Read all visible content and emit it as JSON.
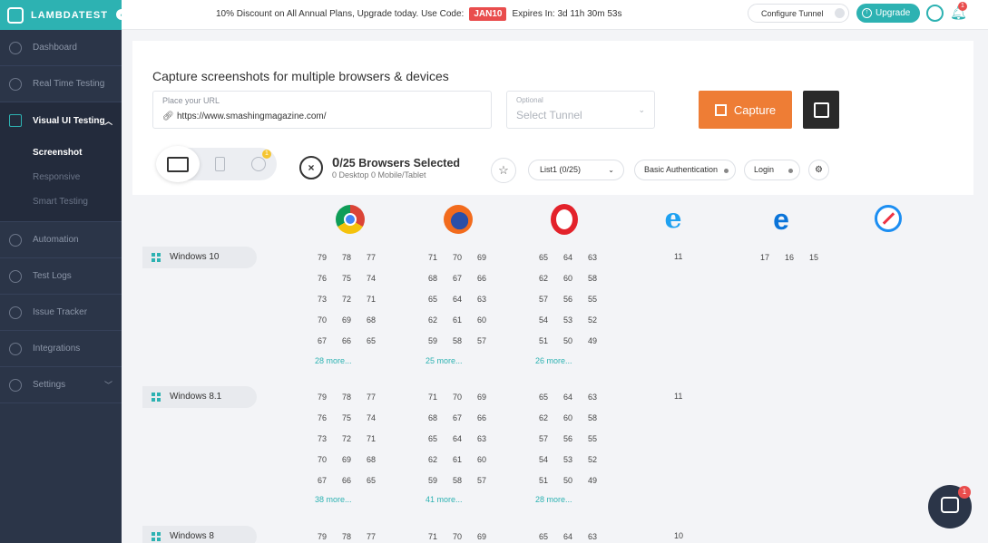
{
  "brand": {
    "name": "LAMBDATEST"
  },
  "sidebar": {
    "items": [
      {
        "label": "Dashboard",
        "icon": "dashboard-icon"
      },
      {
        "label": "Real Time Testing",
        "icon": "clock-icon"
      },
      {
        "label": "Visual UI Testing",
        "icon": "monitor-icon",
        "active": true
      },
      {
        "label": "Automation",
        "icon": "robot-icon"
      },
      {
        "label": "Test Logs",
        "icon": "box-icon"
      },
      {
        "label": "Issue Tracker",
        "icon": "bug-icon"
      },
      {
        "label": "Integrations",
        "icon": "plug-icon"
      },
      {
        "label": "Settings",
        "icon": "gear-icon"
      }
    ],
    "subitems": [
      {
        "label": "Screenshot",
        "active": true
      },
      {
        "label": "Responsive"
      },
      {
        "label": "Smart Testing"
      }
    ]
  },
  "topbar": {
    "promo_text": "10% Discount on All Annual Plans, Upgrade today. Use Code:",
    "promo_code": "JAN10",
    "expires_text": "Expires In: 3d 11h 30m 53s",
    "configure_tunnel": "Configure Tunnel",
    "upgrade": "Upgrade",
    "notification_count": "1"
  },
  "capture": {
    "title": "Capture screenshots for multiple browsers & devices",
    "url_label": "Place your URL",
    "url_value": "https://www.smashingmagazine.com/",
    "tunnel_label": "Optional",
    "tunnel_placeholder": "Select Tunnel",
    "capture_button": "Capture",
    "history_badge": "1",
    "selected_count": "0",
    "selected_suffix": "/25 Browsers Selected",
    "selected_sub": "0 Desktop 0 Mobile/Tablet",
    "list_select": "List1  (0/25)",
    "basic_auth": "Basic Authentication",
    "login": "Login"
  },
  "browsers": [
    "Chrome",
    "Firefox",
    "Opera",
    "Internet Explorer",
    "Edge",
    "Safari"
  ],
  "os_groups": [
    {
      "name": "Windows 10",
      "chrome": [
        "79",
        "78",
        "77",
        "76",
        "75",
        "74",
        "73",
        "72",
        "71",
        "70",
        "69",
        "68",
        "67",
        "66",
        "65"
      ],
      "chrome_more": "28 more...",
      "firefox": [
        "71",
        "70",
        "69",
        "68",
        "67",
        "66",
        "65",
        "64",
        "63",
        "62",
        "61",
        "60",
        "59",
        "58",
        "57"
      ],
      "firefox_more": "25 more...",
      "opera": [
        "65",
        "64",
        "63",
        "62",
        "60",
        "58",
        "57",
        "56",
        "55",
        "54",
        "53",
        "52",
        "51",
        "50",
        "49"
      ],
      "opera_more": "26 more...",
      "ie": "11",
      "edge": [
        "17",
        "16",
        "15"
      ]
    },
    {
      "name": "Windows 8.1",
      "chrome": [
        "79",
        "78",
        "77",
        "76",
        "75",
        "74",
        "73",
        "72",
        "71",
        "70",
        "69",
        "68",
        "67",
        "66",
        "65"
      ],
      "chrome_more": "38 more...",
      "firefox": [
        "71",
        "70",
        "69",
        "68",
        "67",
        "66",
        "65",
        "64",
        "63",
        "62",
        "61",
        "60",
        "59",
        "58",
        "57"
      ],
      "firefox_more": "41 more...",
      "opera": [
        "65",
        "64",
        "63",
        "62",
        "60",
        "58",
        "57",
        "56",
        "55",
        "54",
        "53",
        "52",
        "51",
        "50",
        "49"
      ],
      "opera_more": "28 more...",
      "ie": "11"
    },
    {
      "name": "Windows 8",
      "chrome": [
        "79",
        "78",
        "77"
      ],
      "firefox": [
        "71",
        "70",
        "69"
      ],
      "opera": [
        "65",
        "64",
        "63"
      ],
      "ie": "10"
    }
  ],
  "chat": {
    "badge": "1"
  },
  "colors": {
    "accent": "#2db2b2",
    "sidebar": "#2b3548",
    "capture": "#ee7d35",
    "promo": "#e94d4d"
  }
}
